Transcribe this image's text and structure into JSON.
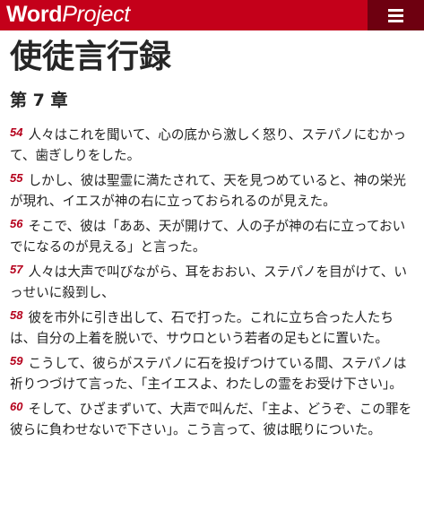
{
  "header": {
    "logo_bold": "Word",
    "logo_italic": "Project",
    "menu_icon": "hamburger-menu-icon",
    "bar_color": "#c4001a",
    "menu_bg_color": "#6e0010"
  },
  "page": {
    "book_title": "使徒言行録",
    "chapter_title": "第 7 章"
  },
  "verses": [
    {
      "num": "54",
      "text": "人々はこれを聞いて、心の底から激しく怒り、ステパノにむかって、歯ぎしりをした。"
    },
    {
      "num": "55",
      "text": "しかし、彼は聖霊に満たされて、天を見つめていると、神の栄光が現れ、イエスが神の右に立っておられるのが見えた。"
    },
    {
      "num": "56",
      "text": "そこで、彼は「ああ、天が開けて、人の子が神の右に立っておいでになるのが見える」と言った。"
    },
    {
      "num": "57",
      "text": "人々は大声で叫びながら、耳をおおい、ステパノを目がけて、いっせいに殺到し、"
    },
    {
      "num": "58",
      "text": "彼を市外に引き出して、石で打った。これに立ち合った人たちは、自分の上着を脱いで、サウロという若者の足もとに置いた。"
    },
    {
      "num": "59",
      "text": "こうして、彼らがステパノに石を投げつけている間、ステパノは祈りつづけて言った、「主イエスよ、わたしの霊をお受け下さい」。"
    },
    {
      "num": "60",
      "text": "そして、ひざまずいて、大声で叫んだ、「主よ、どうぞ、この罪を彼らに負わせないで下さい」。こう言って、彼は眠りについた。"
    }
  ],
  "colors": {
    "verse_number": "#b5001c",
    "text": "#222222"
  }
}
